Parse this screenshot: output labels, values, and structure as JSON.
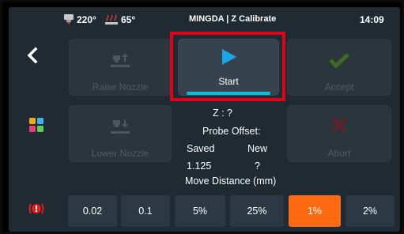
{
  "header": {
    "extruder_temp": "220°",
    "bed_temp": "65°",
    "title": "MINGDA  | Z Calibrate",
    "clock": "14:09"
  },
  "buttons": {
    "raise_label": "Raise Nozzle",
    "lower_label": "Lower Nozzle",
    "start_label": "Start",
    "accept_label": "Accept",
    "abort_label": "Abort"
  },
  "info": {
    "z_value": "Z : ?",
    "probe_offset_label": "Probe Offset:",
    "saved_header": "Saved",
    "new_header": "New",
    "saved_value": "1.125",
    "new_value": "?",
    "move_distance_label": "Move Distance (mm)"
  },
  "steps": [
    "0.02",
    "0.1",
    "5%",
    "25%",
    "1%",
    "2%"
  ],
  "selected_step": "1%",
  "colors": {
    "accent": "#14b8d8",
    "selected_step": "#ff6a13",
    "highlight_frame": "#e0001b",
    "accept_icon": "#7dc22b",
    "abort_icon": "#d21a1a"
  }
}
